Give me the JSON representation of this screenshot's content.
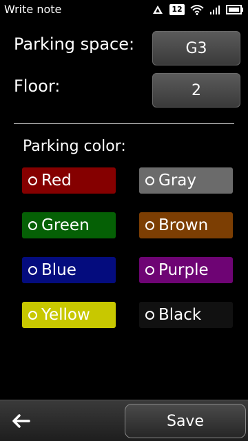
{
  "status_bar": {
    "title": "Write note",
    "notification_count": "12",
    "icons": [
      "signal-icon",
      "notification-count-badge",
      "wifi-icon",
      "signal-bars-icon",
      "battery-icon"
    ]
  },
  "form": {
    "parking_space_label": "Parking space:",
    "parking_space_value": "G3",
    "floor_label": "Floor:",
    "floor_value": "2"
  },
  "colors_section": {
    "title": "Parking color:",
    "options": [
      {
        "label": "Red",
        "color": "#850000"
      },
      {
        "label": "Gray",
        "color": "#6b6b6b"
      },
      {
        "label": "Green",
        "color": "#056005"
      },
      {
        "label": "Brown",
        "color": "#7c3e03"
      },
      {
        "label": "Blue",
        "color": "#040c7e"
      },
      {
        "label": "Purple",
        "color": "#6e0474"
      },
      {
        "label": "Yellow",
        "color": "#c8c800"
      },
      {
        "label": "Black",
        "color": "#111111"
      }
    ]
  },
  "toolbar": {
    "back_icon": "arrow-left-icon",
    "save_label": "Save"
  }
}
